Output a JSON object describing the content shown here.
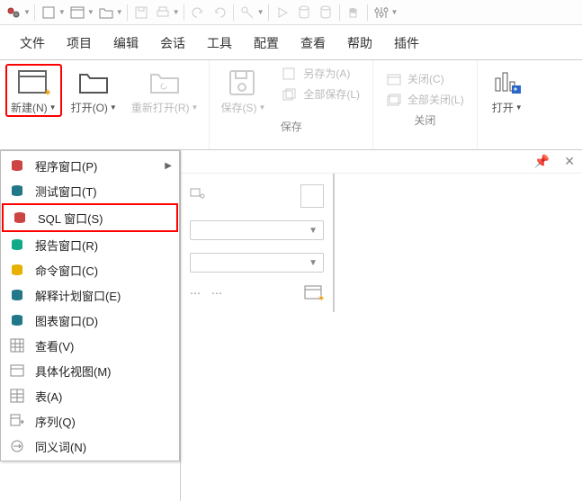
{
  "menu": {
    "file": "文件",
    "project": "项目",
    "edit": "编辑",
    "session": "会话",
    "tools": "工具",
    "config": "配置",
    "view": "查看",
    "help": "帮助",
    "plugins": "插件"
  },
  "ribbon": {
    "new": "新建(N)",
    "open": "打开(O)",
    "reopen": "重新打开(R)",
    "save": "保存(S)",
    "save_as": "另存为(A)",
    "save_all": "全部保存(L)",
    "close": "关闭(C)",
    "close_all": "全部关闭(L)",
    "group_save": "保存",
    "group_close": "关闭",
    "open2": "打开"
  },
  "menu_new": {
    "program": "程序窗口(P)",
    "test": "测试窗口(T)",
    "sql": "SQL 窗口(S)",
    "report": "报告窗口(R)",
    "command": "命令窗口(C)",
    "explain": "解释计划窗口(E)",
    "diagram": "图表窗口(D)",
    "view": "查看(V)",
    "mview": "具体化视图(M)",
    "table": "表(A)",
    "sequence": "序列(Q)",
    "synonym": "同义词(N)"
  }
}
